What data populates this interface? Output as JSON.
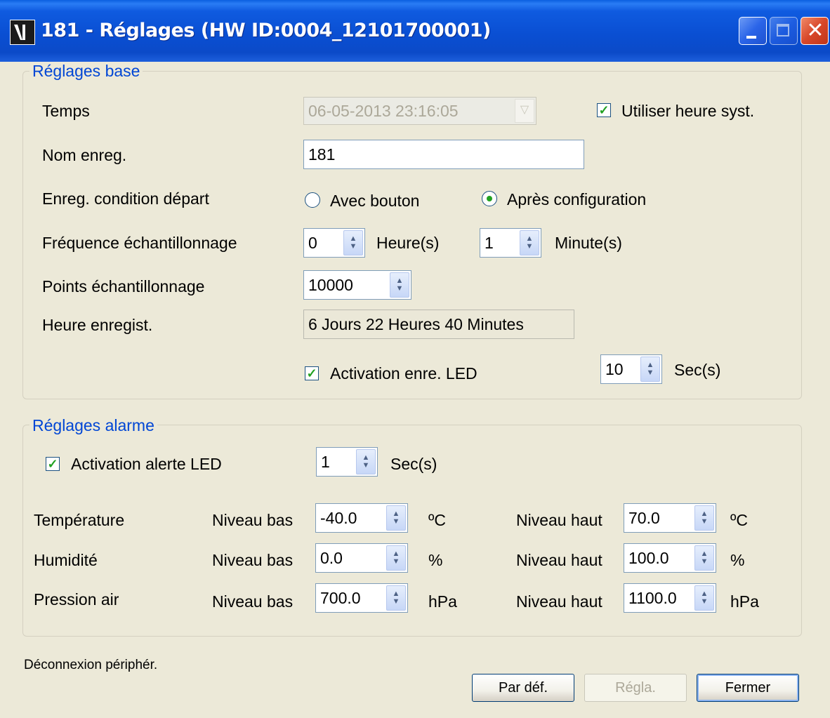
{
  "window": {
    "title": "181 - Réglages (HW ID:0004_12101700001)"
  },
  "base": {
    "legend": "Réglages base",
    "time": {
      "label": "Temps",
      "value": "06-05-2013 23:16:05"
    },
    "use_system_time": {
      "label": "Utiliser heure syst.",
      "checked": true
    },
    "record_name": {
      "label": "Nom enreg.",
      "value": "181"
    },
    "start_condition": {
      "label": "Enreg. condition départ",
      "option_button": "Avec bouton",
      "option_config": "Après configuration",
      "selected": "Après configuration"
    },
    "sampling_freq": {
      "label": "Fréquence échantillonnage",
      "hours": "0",
      "hours_unit": "Heure(s)",
      "minutes": "1",
      "minutes_unit": "Minute(s)"
    },
    "sampling_points": {
      "label": "Points échantillonnage",
      "value": "10000"
    },
    "record_time": {
      "label": "Heure enregist.",
      "value": "6 Jours 22 Heures 40 Minutes"
    },
    "led_record": {
      "label": "Activation enre. LED",
      "checked": true,
      "value": "10",
      "unit": "Sec(s)"
    }
  },
  "alarm": {
    "legend": "Réglages alarme",
    "led_alert": {
      "label": "Activation alerte LED",
      "checked": true,
      "value": "1",
      "unit": "Sec(s)"
    },
    "low_label": "Niveau bas",
    "high_label": "Niveau haut",
    "rows": [
      {
        "name": "Température",
        "low": "-40.0",
        "high": "70.0",
        "unit": "ºC"
      },
      {
        "name": "Humidité",
        "low": "0.0",
        "high": "100.0",
        "unit": "%"
      },
      {
        "name": "Pression air",
        "low": "700.0",
        "high": "1100.0",
        "unit": "hPa"
      }
    ]
  },
  "status": "Déconnexion périphér.",
  "buttons": {
    "default": "Par déf.",
    "apply": "Régla.",
    "close": "Fermer"
  },
  "colors": {
    "accent": "#0046d5",
    "titlebar": "#0a4fd3",
    "face": "#ece9d8"
  }
}
